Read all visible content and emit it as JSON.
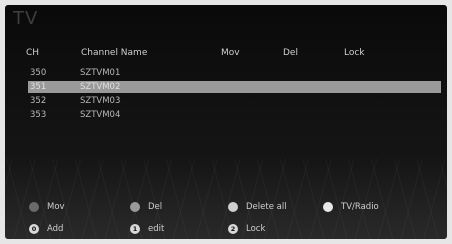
{
  "screen": {
    "title": "TV"
  },
  "table": {
    "headers": {
      "ch": "CH",
      "name": "Channel Name",
      "mov": "Mov",
      "del": "Del",
      "lock": "Lock"
    },
    "rows": [
      {
        "ch": "350",
        "name": "SZTVM01",
        "selected": false
      },
      {
        "ch": "351",
        "name": "SZTVM02",
        "selected": true
      },
      {
        "ch": "352",
        "name": "SZTVM03",
        "selected": false
      },
      {
        "ch": "353",
        "name": "SZTVM04",
        "selected": false
      }
    ]
  },
  "keys": {
    "mov": {
      "label": "Mov",
      "icon": "dark-dot-icon"
    },
    "del": {
      "label": "Del",
      "icon": "gray-dot-icon"
    },
    "delete_all": {
      "label": "Delete all",
      "icon": "light-dot-icon"
    },
    "tv_radio": {
      "label": "TV/Radio",
      "icon": "white-dot-icon"
    },
    "add": {
      "label": "Add",
      "num": "0",
      "icon": "key-0-icon"
    },
    "edit": {
      "label": "edit",
      "num": "1",
      "icon": "key-1-icon"
    },
    "lock": {
      "label": "Lock",
      "num": "2",
      "icon": "key-2-icon"
    }
  }
}
